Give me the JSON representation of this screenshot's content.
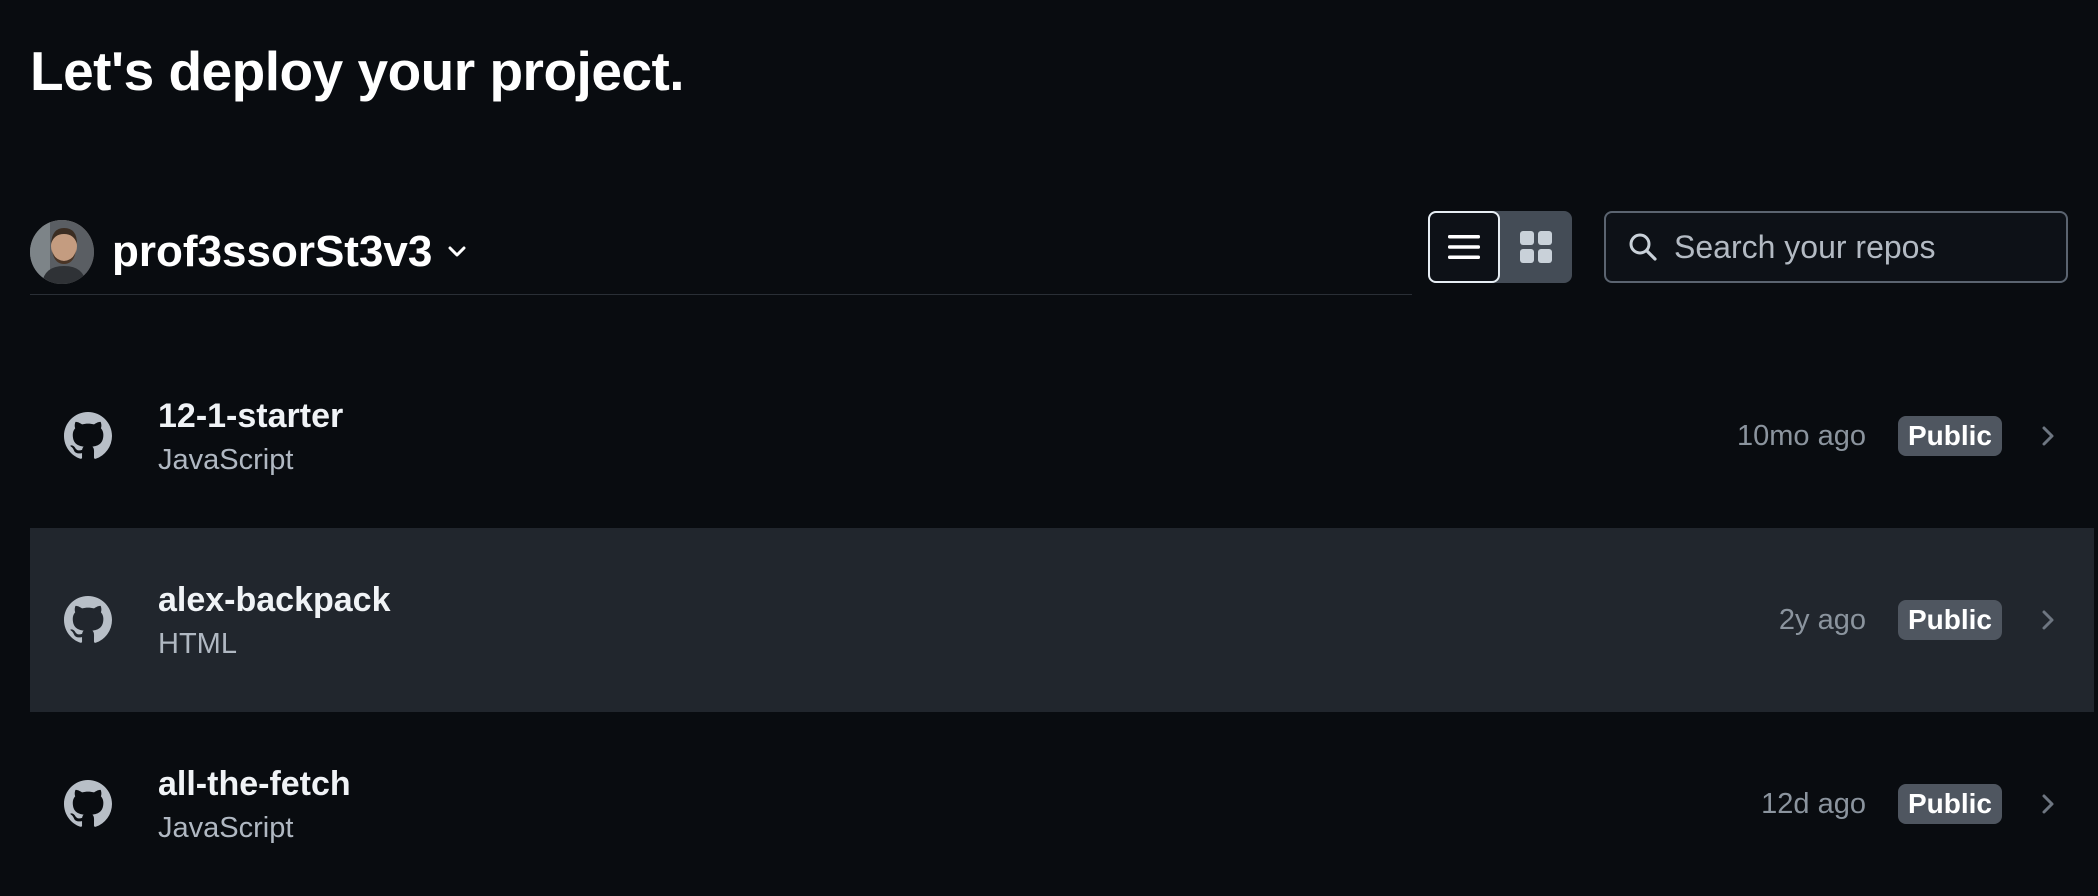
{
  "page": {
    "title": "Let's deploy your project."
  },
  "account": {
    "name": "prof3ssorSt3v3",
    "avatar_icon": "user-avatar"
  },
  "view_toggle": {
    "list_icon": "list-icon",
    "grid_icon": "grid-icon",
    "active": "list"
  },
  "search": {
    "placeholder": "Search your repos",
    "value": "",
    "icon": "search-icon"
  },
  "repos": [
    {
      "name": "12-1-starter",
      "language": "JavaScript",
      "updated": "10mo ago",
      "visibility": "Public",
      "icon": "github-icon"
    },
    {
      "name": "alex-backpack",
      "language": "HTML",
      "updated": "2y ago",
      "visibility": "Public",
      "icon": "github-icon"
    },
    {
      "name": "all-the-fetch",
      "language": "JavaScript",
      "updated": "12d ago",
      "visibility": "Public",
      "icon": "github-icon"
    }
  ],
  "colors": {
    "background": "#090c10",
    "row_hover": "#21262d",
    "badge": "#4f5660",
    "text_primary": "#f0f3f6",
    "text_muted": "#8b949e"
  }
}
